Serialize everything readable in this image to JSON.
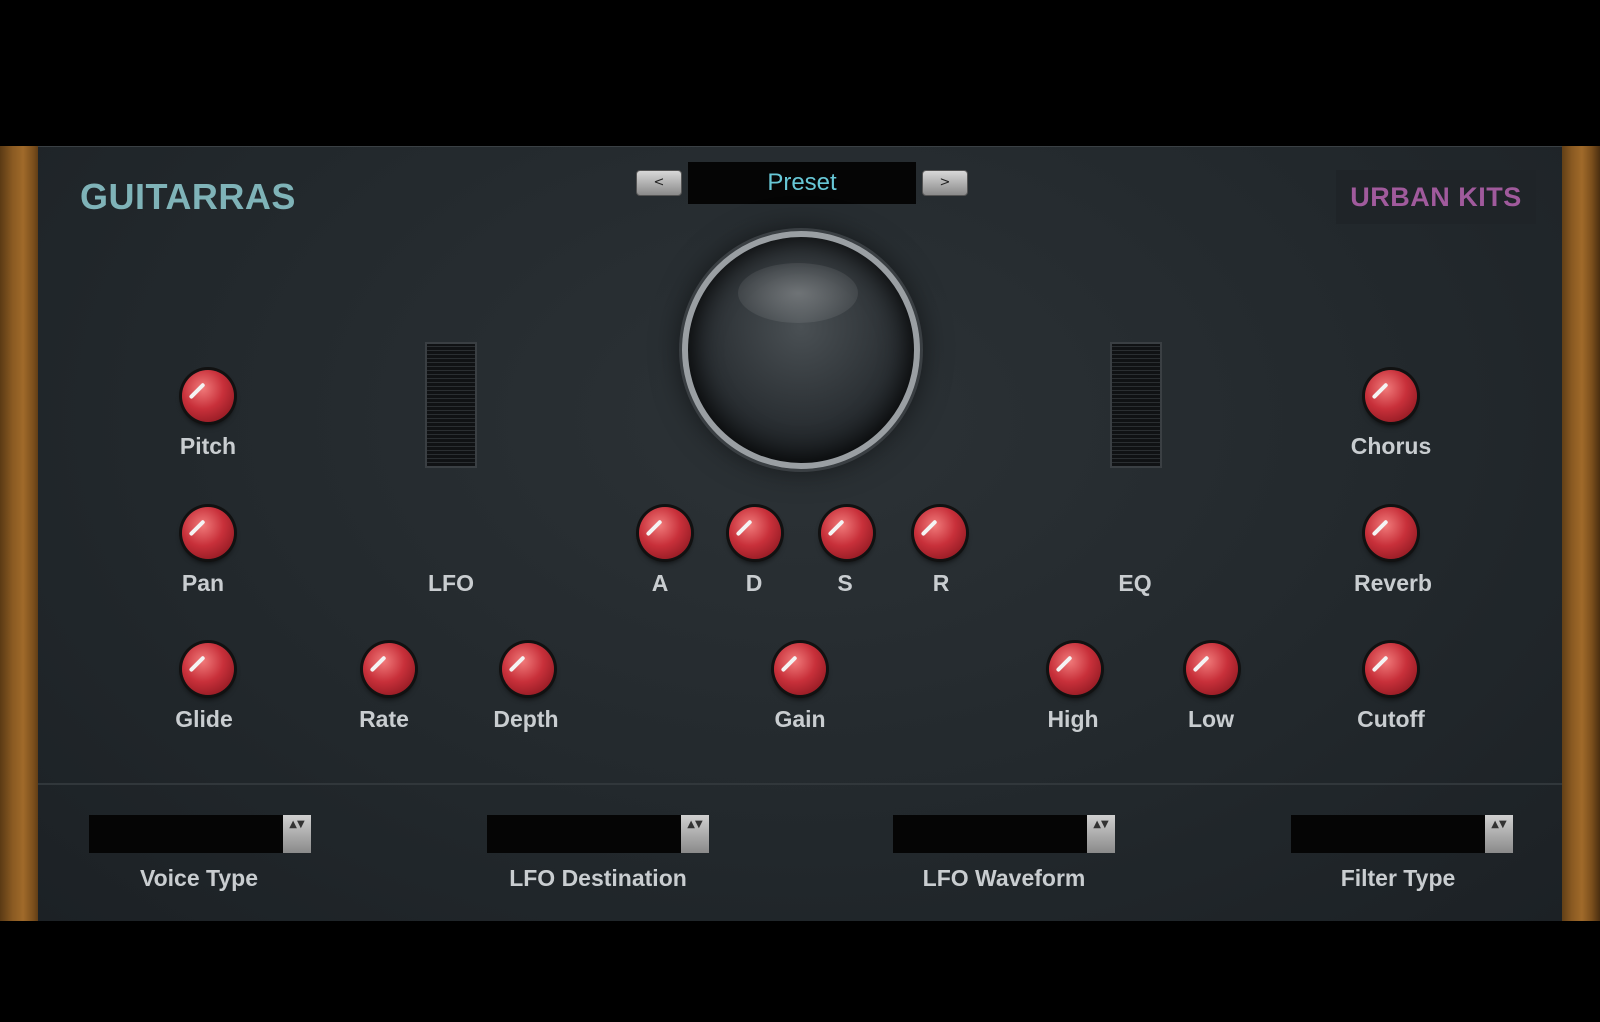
{
  "brand": {
    "left": "GUITARRAS",
    "right": "URBAN KITS"
  },
  "preset": {
    "prev_label": "<",
    "next_label": ">",
    "name": "Preset"
  },
  "knobs": {
    "pitch": "Pitch",
    "pan": "Pan",
    "glide": "Glide",
    "rate": "Rate",
    "depth": "Depth",
    "attack": "A",
    "decay": "D",
    "sustain": "S",
    "release": "R",
    "gain": "Gain",
    "high": "High",
    "low": "Low",
    "chorus": "Chorus",
    "reverb": "Reverb",
    "cutoff": "Cutoff"
  },
  "sections": {
    "lfo": "LFO",
    "eq": "EQ"
  },
  "selects": {
    "voice_type": "Voice Type",
    "lfo_destination": "LFO Destination",
    "lfo_waveform": "LFO Waveform",
    "filter_type": "Filter Type",
    "arrow": "▲▼"
  },
  "colors": {
    "panel": "#22282c",
    "brand_left": "#7fb3b8",
    "brand_right": "#a05a9c",
    "preset_text": "#67c7d6",
    "knob": "#c8303a"
  }
}
